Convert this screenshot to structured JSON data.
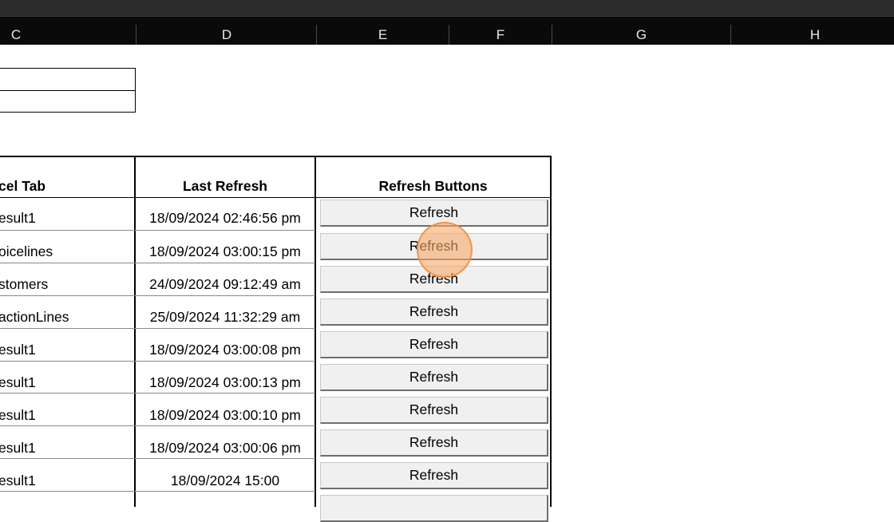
{
  "columns": [
    "C",
    "D",
    "E",
    "F",
    "G",
    "H"
  ],
  "table": {
    "headers": {
      "tab": "cel Tab",
      "last_refresh": "Last Refresh",
      "buttons": "Refresh Buttons"
    },
    "rows": [
      {
        "tab": "esult1",
        "ts": "18/09/2024 02:46:56 pm",
        "btn": "Refresh"
      },
      {
        "tab": "oicelines",
        "ts": "18/09/2024 03:00:15 pm",
        "btn": "Refresh"
      },
      {
        "tab": "stomers",
        "ts": "24/09/2024 09:12:49 am",
        "btn": "Refresh"
      },
      {
        "tab": "actionLines",
        "ts": "25/09/2024 11:32:29 am",
        "btn": "Refresh"
      },
      {
        "tab": "esult1",
        "ts": "18/09/2024 03:00:08 pm",
        "btn": "Refresh"
      },
      {
        "tab": "esult1",
        "ts": "18/09/2024 03:00:13 pm",
        "btn": "Refresh"
      },
      {
        "tab": "esult1",
        "ts": "18/09/2024 03:00:10 pm",
        "btn": "Refresh"
      },
      {
        "tab": "esult1",
        "ts": "18/09/2024 03:00:06 pm",
        "btn": "Refresh"
      },
      {
        "tab": "esult1",
        "ts": "18/09/2024 15:00",
        "btn": "Refresh"
      }
    ]
  },
  "colors": {
    "header_bg": "#0a0a0a",
    "button_bg": "#f0f0f0",
    "cursor": "#f6a868"
  }
}
